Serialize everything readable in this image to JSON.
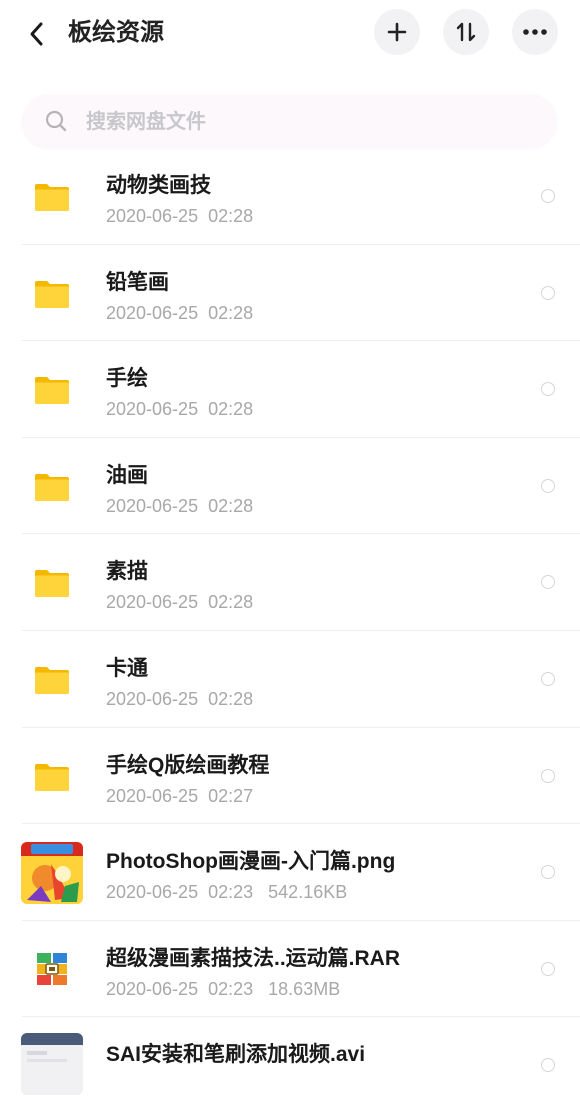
{
  "header": {
    "title": "板绘资源",
    "icons": {
      "back": "chevron-left-icon",
      "add": "plus-icon",
      "sort": "sort-icon",
      "more": "more-icon"
    }
  },
  "search": {
    "placeholder": "搜索网盘文件",
    "value": ""
  },
  "files": [
    {
      "name": "动物类画技",
      "date": "2020-06-25",
      "time": "02:28",
      "size": "",
      "icon": "folder-icon"
    },
    {
      "name": "铅笔画",
      "date": "2020-06-25",
      "time": "02:28",
      "size": "",
      "icon": "folder-icon"
    },
    {
      "name": "手绘",
      "date": "2020-06-25",
      "time": "02:28",
      "size": "",
      "icon": "folder-icon"
    },
    {
      "name": "油画",
      "date": "2020-06-25",
      "time": "02:28",
      "size": "",
      "icon": "folder-icon"
    },
    {
      "name": "素描",
      "date": "2020-06-25",
      "time": "02:28",
      "size": "",
      "icon": "folder-icon"
    },
    {
      "name": "卡通",
      "date": "2020-06-25",
      "time": "02:28",
      "size": "",
      "icon": "folder-icon"
    },
    {
      "name": "手绘Q版绘画教程",
      "date": "2020-06-25",
      "time": "02:27",
      "size": "",
      "icon": "folder-icon"
    },
    {
      "name": "PhotoShop画漫画-入门篇.png",
      "date": "2020-06-25",
      "time": "02:23",
      "size": "542.16KB",
      "icon": "image-thumbnail"
    },
    {
      "name": "超级漫画素描技法..运动篇.RAR",
      "date": "2020-06-25",
      "time": "02:23",
      "size": "18.63MB",
      "icon": "archive-icon"
    },
    {
      "name": "SAI安装和笔刷添加视频.avi",
      "date": "",
      "time": "",
      "size": "",
      "icon": "video-thumbnail"
    }
  ],
  "colors": {
    "folder": "#FFD43B",
    "folder_back": "#F5B800",
    "meta_text": "#A8A8A8",
    "search_bg": "#FDF8FB"
  }
}
